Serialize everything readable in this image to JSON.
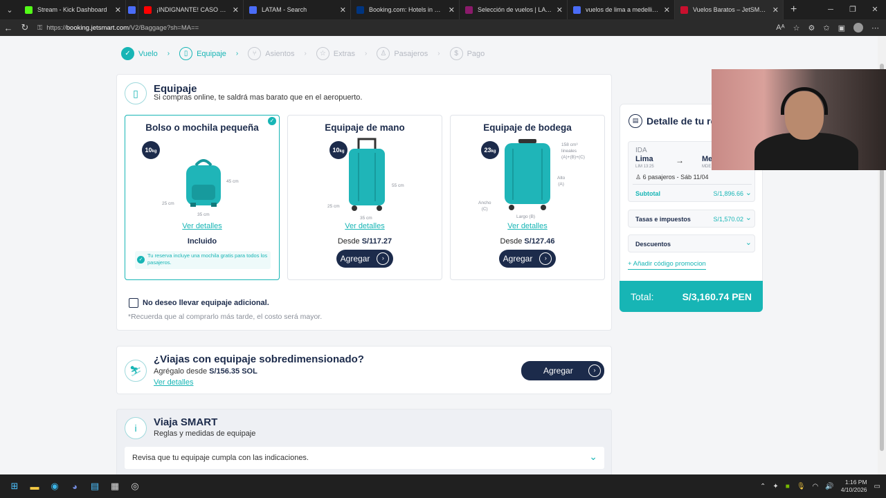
{
  "browser": {
    "tabs": [
      {
        "title": "Stream - Kick Dashboard",
        "color": "#53fc18"
      },
      {
        "title": "",
        "color": "#4a6cf7"
      },
      {
        "title": "¡INDIGNANTE! CASO SMASH Y D",
        "color": "#ff0000"
      },
      {
        "title": "LATAM - Search",
        "color": "#4a6cf7"
      },
      {
        "title": "Booking.com: Hotels in Medellín",
        "color": "#003580"
      },
      {
        "title": "Selección de vuelos | LATAM Airli",
        "color": "#8b1a6b"
      },
      {
        "title": "vuelos de lima a medellin - Searc",
        "color": "#4a6cf7"
      },
      {
        "title": "Vuelos Baratos – JetSMART Avion",
        "color": "#c8102e"
      }
    ],
    "url_prefix": "https://",
    "url_host": "booking.jetsmart.com",
    "url_path": "/V2/Baggage?sh=MA=="
  },
  "steps": [
    {
      "label": "Vuelo",
      "state": "done",
      "icon": "check-icon"
    },
    {
      "label": "Equipaje",
      "state": "current",
      "icon": "suitcase-icon"
    },
    {
      "label": "Asientos",
      "state": "pending",
      "icon": "seat-icon"
    },
    {
      "label": "Extras",
      "state": "pending",
      "icon": "star-icon"
    },
    {
      "label": "Pasajeros",
      "state": "pending",
      "icon": "person-icon"
    },
    {
      "label": "Pago",
      "state": "pending",
      "icon": "dollar-icon"
    }
  ],
  "baggage": {
    "title": "Equipaje",
    "subtitle": "Si compras online, te saldrá mas barato que en el aeropuerto.",
    "options": [
      {
        "title": "Bolso o mochila pequeña",
        "kg": "10",
        "unit": "kg",
        "link": "Ver detalles",
        "status": "Incluido",
        "note": "Tu reserva incluye una mochila gratis para todos los pasajeros.",
        "dims": [
          "45 cm",
          "25 cm",
          "35 cm"
        ]
      },
      {
        "title": "Equipaje de mano",
        "kg": "10",
        "unit": "kg",
        "link": "Ver detalles",
        "price_prefix": "Desde ",
        "price": "S/117.27",
        "button": "Agregar",
        "dims": [
          "55 cm",
          "25 cm",
          "35 cm"
        ]
      },
      {
        "title": "Equipaje de bodega",
        "kg": "23",
        "unit": "kg",
        "link": "Ver detalles",
        "price_prefix": "Desde ",
        "price": "S/127.46",
        "button": "Agregar",
        "dims": [
          "158 cm³",
          "lineales",
          "(A)+(B)+(C)",
          "Alto",
          "(A)",
          "Ancho",
          "(C)",
          "Largo (B)"
        ]
      }
    ],
    "no_extra_label": "No deseo llevar equipaje adicional.",
    "no_extra_note": "*Recuerda que al comprarlo más tarde, el costo será mayor."
  },
  "oversize": {
    "title": "¿Viajas con equipaje sobredimensionado?",
    "text_prefix": "Agrégalo desde ",
    "price": "S/156.35 SOL",
    "link": "Ver detalles",
    "button": "Agregar"
  },
  "smart": {
    "title": "Viaja SMART",
    "subtitle": "Reglas y medidas de equipaje",
    "row": "Revisa que tu equipaje cumpla con las indicaciones."
  },
  "summary": {
    "title": "Detalle de tu re",
    "direction": "IDA",
    "origin": "Lima",
    "origin_code": "LIM 13:25",
    "dest": "Me",
    "dest_code": "MDE",
    "pax": "6 pasajeros - Sáb 11/04",
    "subtotal_label": "Subtotal",
    "subtotal": "S/1,896.66",
    "taxes_label": "Tasas e impuestos",
    "taxes": "S/1,570.02",
    "discounts_label": "Descuentos",
    "promo": "Añadir código promocion",
    "total_label": "Total:",
    "total": "S/3,160.74 PEN"
  },
  "taskbar": {
    "time": "1:16 PM",
    "date": "4/10/2026"
  },
  "colors": {
    "teal": "#17b5b5",
    "navy": "#1c2b4b"
  }
}
